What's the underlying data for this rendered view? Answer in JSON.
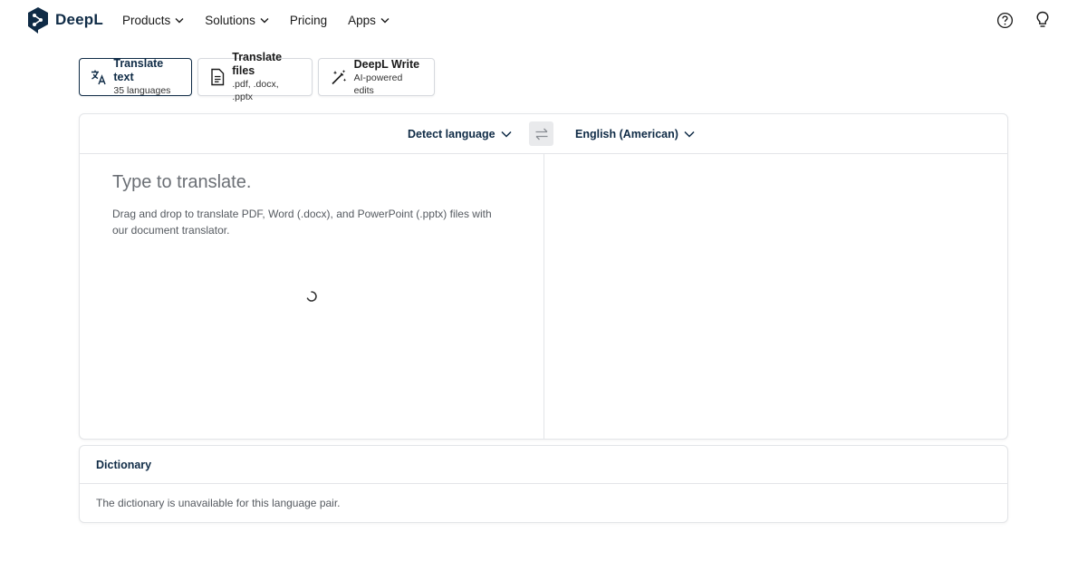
{
  "header": {
    "logo_text": "DeepL",
    "nav": [
      {
        "label": "Products",
        "has_dropdown": true
      },
      {
        "label": "Solutions",
        "has_dropdown": true
      },
      {
        "label": "Pricing",
        "has_dropdown": false
      },
      {
        "label": "Apps",
        "has_dropdown": true
      }
    ],
    "icons": [
      "help-icon",
      "lightbulb-icon"
    ]
  },
  "modes": [
    {
      "title": "Translate text",
      "subtitle": "35 languages",
      "icon": "translate-icon",
      "active": true
    },
    {
      "title": "Translate files",
      "subtitle": ".pdf, .docx, .pptx",
      "icon": "document-icon",
      "active": false
    },
    {
      "title": "DeepL Write",
      "subtitle": "AI-powered edits",
      "icon": "magic-wand-icon",
      "active": false
    }
  ],
  "translator": {
    "source_language": "Detect language",
    "target_language": "English (American)",
    "source_placeholder": "Type to translate.",
    "source_hint": "Drag and drop to translate PDF, Word (.docx), and PowerPoint (.pptx) files with our document translator.",
    "target_text": ""
  },
  "dictionary": {
    "title": "Dictionary",
    "message": "The dictionary is unavailable for this language pair."
  },
  "colors": {
    "brand_navy": "#0f2b46",
    "border": "#e3e5e8",
    "swap_bg": "#e9eaec"
  }
}
